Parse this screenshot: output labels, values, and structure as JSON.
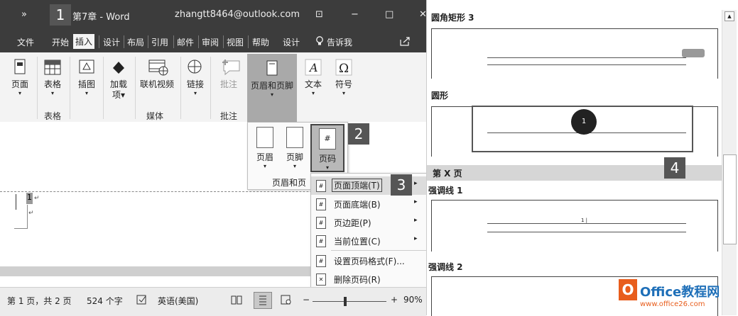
{
  "window": {
    "qat_icon": "»",
    "title": "第7章  -  Word",
    "account": "zhangtt8464@outlook.com",
    "ribbon_display_icon": "⊡",
    "minimize": "−",
    "maximize": "□",
    "close": "✕"
  },
  "tabs": [
    "文件",
    "开始",
    "插入",
    "设计",
    "布局",
    "引用",
    "邮件",
    "审阅",
    "视图",
    "帮助",
    "设计"
  ],
  "tell_me": "告诉我",
  "ribbon": {
    "page": "页面",
    "table": "表格",
    "illustrations": "插图",
    "addins_line1": "加载",
    "addins_line2": "项",
    "online_video": "联机视频",
    "link": "链接",
    "comment": "批注",
    "header_footer": "页眉和页脚",
    "text": "文本",
    "symbol": "符号",
    "groups": {
      "tables": "表格",
      "media": "媒体",
      "comments": "批注"
    }
  },
  "hf_panel": {
    "header": "页眉",
    "footer": "页脚",
    "page_number": "页码",
    "group_label": "页眉和页"
  },
  "menu": {
    "items": [
      "页面顶端(T)",
      "页面底端(B)",
      "页边距(P)",
      "当前位置(C)",
      "设置页码格式(F)...",
      "删除页码(R)"
    ]
  },
  "steps": [
    "1",
    "2",
    "3",
    "4"
  ],
  "document": {
    "page_num_marker": "1"
  },
  "status": {
    "page": "第 1 页，共 2 页",
    "words": "524 个字",
    "language": "英语(美国)",
    "zoom": "90%"
  },
  "gallery": {
    "section1": "圆角矩形 3",
    "section2": "圆形",
    "circle_number": "1",
    "section_highlight": "第 X 页",
    "section3": "强调线 1",
    "accent_number": "1 |",
    "section4": "强调线 2"
  },
  "watermark": {
    "brand": "Office教程网",
    "url": "www.office26.com"
  },
  "colors": {
    "title_bar": "#3c3c3c",
    "ribbon": "#f3f3f3",
    "highlight": "#dcdcdc",
    "badge": "#555555"
  }
}
